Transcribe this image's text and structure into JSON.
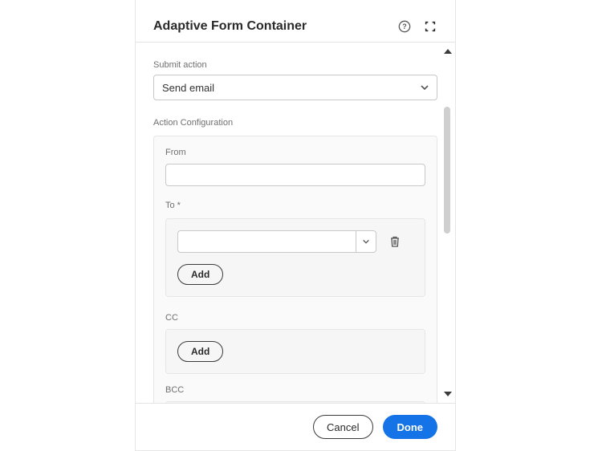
{
  "header": {
    "title": "Adaptive Form Container"
  },
  "submit": {
    "label": "Submit action",
    "selected": "Send email"
  },
  "config": {
    "sectionLabel": "Action Configuration",
    "fromLabel": "From",
    "fromValue": "",
    "to": {
      "label": "To *",
      "value": "",
      "addLabel": "Add"
    },
    "cc": {
      "label": "CC",
      "addLabel": "Add"
    },
    "bcc": {
      "label": "BCC"
    }
  },
  "footer": {
    "cancelLabel": "Cancel",
    "doneLabel": "Done"
  }
}
